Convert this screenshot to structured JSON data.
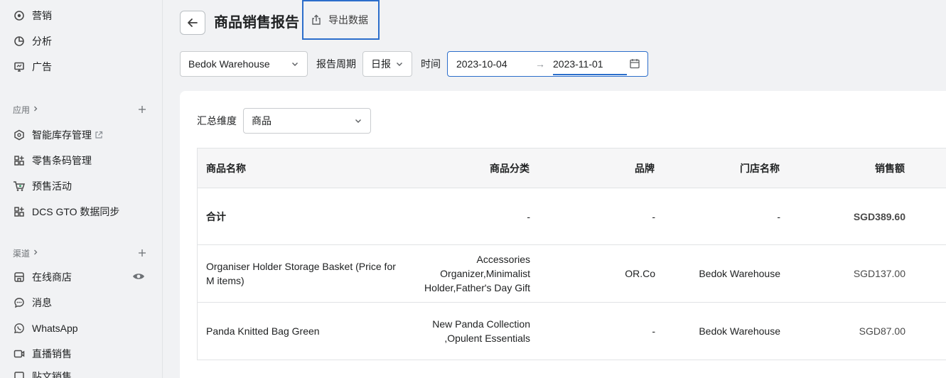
{
  "sidebar": {
    "top_items": [
      {
        "label": "营销",
        "icon": "marketing-icon"
      },
      {
        "label": "分析",
        "icon": "analytics-icon"
      },
      {
        "label": "广告",
        "icon": "ads-icon"
      }
    ],
    "apps_section": {
      "label": "应用"
    },
    "app_items": [
      {
        "label": "智能库存管理",
        "icon": "cube-icon",
        "external": true
      },
      {
        "label": "零售条码管理",
        "icon": "apps-icon"
      },
      {
        "label": "预售活动",
        "icon": "cart-icon"
      },
      {
        "label": "DCS GTO 数据同步",
        "icon": "apps-icon"
      }
    ],
    "channels_section": {
      "label": "渠道"
    },
    "channel_items": [
      {
        "label": "在线商店",
        "icon": "store-icon"
      },
      {
        "label": "消息",
        "icon": "chat-icon"
      },
      {
        "label": "WhatsApp",
        "icon": "whatsapp-icon"
      },
      {
        "label": "直播销售",
        "icon": "live-icon"
      },
      {
        "label": "贴文销售",
        "icon": "post-icon"
      }
    ]
  },
  "header": {
    "title": "商品销售报告",
    "export_label": "导出数据"
  },
  "filters": {
    "warehouse": "Bedok Warehouse",
    "period_label": "报告周期",
    "period_value": "日报",
    "time_label": "时间",
    "date_start": "2023-10-04",
    "date_arrow": "→",
    "date_end": "2023-11-01"
  },
  "summary": {
    "dimension_label": "汇总维度",
    "dimension_value": "商品"
  },
  "table": {
    "columns": [
      "商品名称",
      "商品分类",
      "品牌",
      "门店名称",
      "销售额"
    ],
    "total_row": {
      "name": "合计",
      "category": "-",
      "brand": "-",
      "store": "-",
      "sales": "SGD389.60"
    },
    "rows": [
      {
        "name_lines": [
          "Organiser Holder Storage Basket (Price for",
          "M items)"
        ],
        "category_lines": [
          "Accessories",
          "Organizer,Minimalist",
          "Holder,Father's Day Gift"
        ],
        "brand": "OR.Co",
        "store": "Bedok Warehouse",
        "sales": "SGD137.00"
      },
      {
        "name_lines": [
          "Panda Knitted Bag Green"
        ],
        "category_lines": [
          "New Panda Collection",
          ",Opulent Essentials"
        ],
        "brand": "-",
        "store": "Bedok Warehouse",
        "sales": "SGD87.00"
      }
    ]
  }
}
